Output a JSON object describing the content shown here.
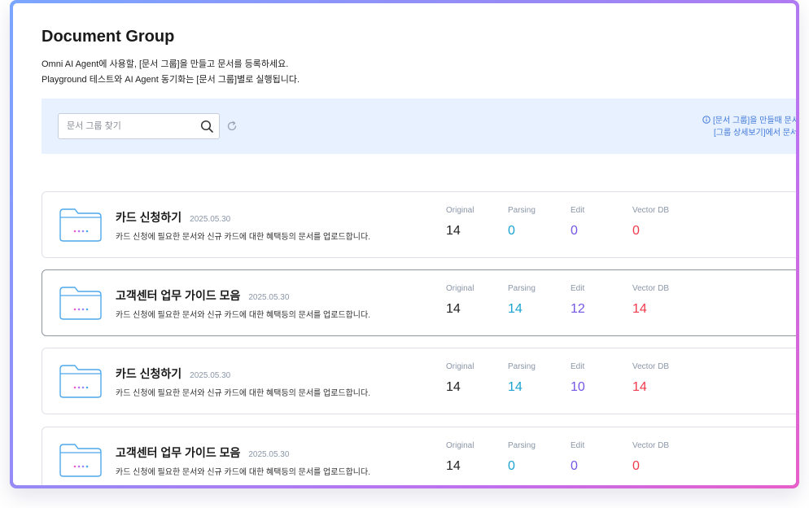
{
  "header": {
    "title": "Document Group",
    "description_line1": "Omni AI Agent에 사용할, [문서 그룹]을 만들고 문서를 등록하세요.",
    "description_line2": "Playground 테스트와 AI Agent 동기화는 [문서 그룹]별로 실행됩니다."
  },
  "search": {
    "placeholder": "문서 그룹 찾기",
    "value": "",
    "search_icon": "search-icon",
    "refresh_icon": "refresh-icon"
  },
  "notice": {
    "icon": "info-icon",
    "line1": "[문서 그룹]을 만들때 문서",
    "line2": "[그룹 상세보기]에서 문서 -"
  },
  "stat_labels": {
    "original": "Original",
    "parsing": "Parsing",
    "edit": "Edit",
    "vector_db": "Vector DB"
  },
  "colors": {
    "accent_band": "#e8f1ff",
    "parsing": "#1aa3d1",
    "edit": "#7456e6",
    "vector_db": "#ef3a4c"
  },
  "groups": [
    {
      "name": "카드 신청하기",
      "date": "2025.05.30",
      "description": "카드 신청에 필요한 문서와 신규 카드에 대한 혜택등의 문서를 업로드합니다.",
      "original": "14",
      "parsing": "0",
      "edit": "0",
      "vector_db": "0"
    },
    {
      "name": "고객센터 업무 가이드 모음",
      "date": "2025.05.30",
      "description": "카드 신청에 필요한 문서와 신규 카드에 대한 혜택등의 문서를 업로드합니다.",
      "original": "14",
      "parsing": "14",
      "edit": "12",
      "vector_db": "14"
    },
    {
      "name": "카드 신청하기",
      "date": "2025.05.30",
      "description": "카드 신청에 필요한 문서와 신규 카드에 대한 혜택등의 문서를 업로드합니다.",
      "original": "14",
      "parsing": "14",
      "edit": "10",
      "vector_db": "14"
    },
    {
      "name": "고객센터 업무 가이드 모음",
      "date": "2025.05.30",
      "description": "카드 신청에 필요한 문서와 신규 카드에 대한 혜택등의 문서를 업로드합니다.",
      "original": "14",
      "parsing": "0",
      "edit": "0",
      "vector_db": "0"
    }
  ]
}
